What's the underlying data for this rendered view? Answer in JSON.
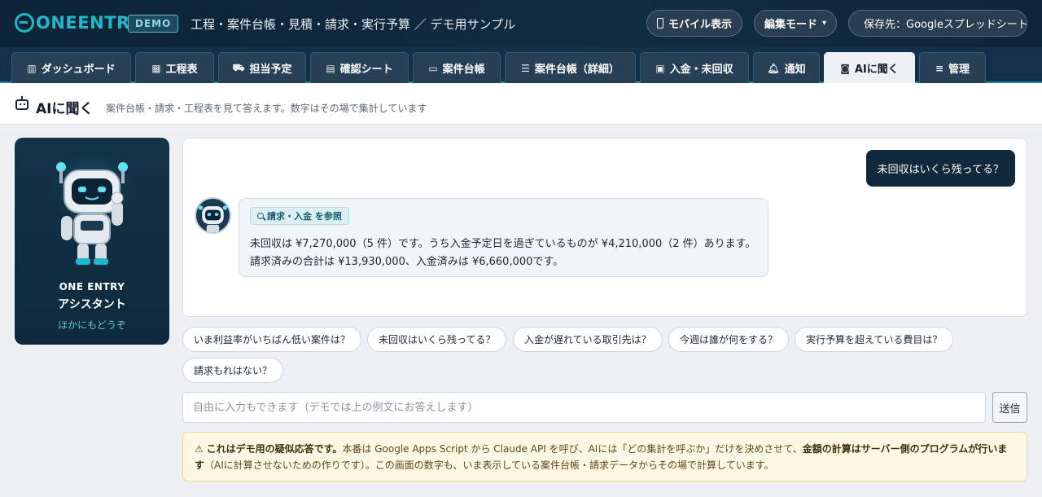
{
  "header": {
    "logo": "ONEENTRY",
    "demo_badge": "DEMO",
    "app_title": "工程・案件台帳・見積・請求・実行予算 ／ デモ用サンプル",
    "mobile_label": "モバイル表示",
    "edit_mode_label": "編集モード",
    "save_target_label": "保存先：Googleスプレッドシート"
  },
  "tabs": [
    {
      "label": "ダッシュボード",
      "icon": "chart-icon"
    },
    {
      "label": "工程表",
      "icon": "calendar-icon"
    },
    {
      "label": "担当予定",
      "icon": "truck-icon"
    },
    {
      "label": "確認シート",
      "icon": "clipboard-icon"
    },
    {
      "label": "案件台帳",
      "icon": "folder-icon"
    },
    {
      "label": "案件台帳（詳細）",
      "icon": "list-icon"
    },
    {
      "label": "入金・未回収",
      "icon": "money-icon"
    },
    {
      "label": "通知",
      "icon": "bell-icon"
    },
    {
      "label": "AIに聞く",
      "icon": "robot-icon",
      "active": true
    },
    {
      "label": "管理",
      "icon": "sliders-icon"
    }
  ],
  "page": {
    "title": "AIに聞く",
    "subtitle": "案件台帳・請求・工程表を見て答えます。数字はその場で集計しています"
  },
  "assistant": {
    "name_en": "ONE ENTRY",
    "name_ja": "アシスタント",
    "tagline": "ほかにもどうぞ"
  },
  "chat": {
    "user_message": "未回収はいくら残ってる？",
    "reference_tag": "請求・入金 を参照",
    "bot_line1": "未回収は ¥7,270,000（5 件）です。うち入金予定日を過ぎているものが ¥4,210,000（2 件）あります。",
    "bot_line2": "請求済みの合計は ¥13,930,000、入金済みは ¥6,660,000です。"
  },
  "suggestions": [
    "いま利益率がいちばん低い案件は？",
    "未回収はいくら残ってる？",
    "入金が遅れている取引先は？",
    "今週は誰が何をする？",
    "実行予算を超えている費目は？",
    "請求もれはない？"
  ],
  "input": {
    "placeholder": "自由に入力もできます（デモでは上の例文にお答えします）",
    "value": "",
    "send_label": "送信"
  },
  "notice": {
    "icon": "⚠",
    "bold1": "これはデモ用の疑似応答です。",
    "text1": "本番は Google Apps Script から Claude API を呼び、AIには「どの集計を呼ぶか」だけを決めさせて、",
    "bold2": "金額の計算はサーバー側のプログラムが行います",
    "text2": "（AIに計算させないための作りです）。この画面の数字も、いま表示している案件台帳・請求データからその場で計算しています。"
  },
  "colors": {
    "header_bg": "#0d2436",
    "accent": "#1fb7c9",
    "user_bubble": "#12293b",
    "notice_bg": "#fdf7e6"
  }
}
